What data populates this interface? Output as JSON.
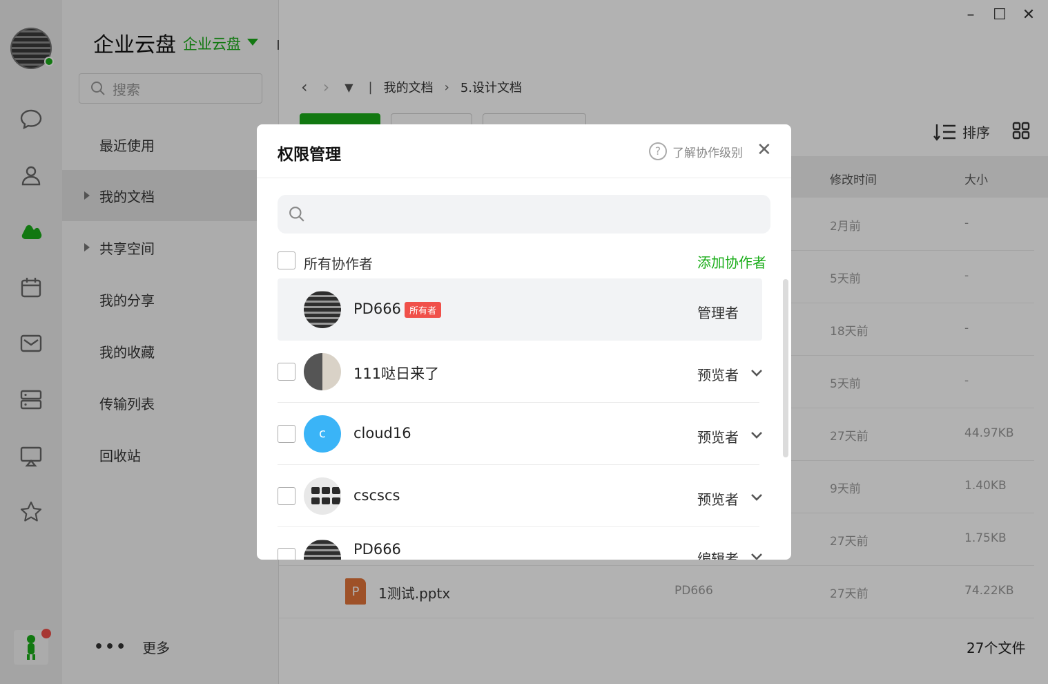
{
  "app": {
    "title": "企业云盘",
    "title_sub": "企业云盘"
  },
  "nav": {
    "search_placeholder": "搜索",
    "items": [
      {
        "label": "最近使用"
      },
      {
        "label": "我的文档"
      },
      {
        "label": "共享空间"
      },
      {
        "label": "我的分享"
      },
      {
        "label": "我的收藏"
      },
      {
        "label": "传输列表"
      },
      {
        "label": "回收站"
      }
    ],
    "more_label": "更多"
  },
  "window": {
    "minimize": "–",
    "maximize": "☐",
    "close": "✕"
  },
  "breadcrumb": {
    "root": "我的文档",
    "current": "5.设计文档"
  },
  "toolbar": {
    "sort_label": "排序"
  },
  "table": {
    "headers": {
      "modified": "修改时间",
      "size": "大小"
    },
    "rows": [
      {
        "time": "2月前",
        "size": "-"
      },
      {
        "time": "5天前",
        "size": "-"
      },
      {
        "time": "18天前",
        "size": "-"
      },
      {
        "time": "5天前",
        "size": "-"
      },
      {
        "time": "27天前",
        "size": "44.97KB"
      },
      {
        "time": "9天前",
        "size": "1.40KB"
      },
      {
        "time": "27天前",
        "size": "1.75KB"
      },
      {
        "name": "1测试.pptx",
        "owner": "PD666",
        "time": "27天前",
        "size": "74.22KB",
        "icon_letter": "P"
      }
    ],
    "file_count": "27个文件"
  },
  "modal": {
    "title": "权限管理",
    "help_label": "了解协作级别",
    "search_placeholder": "",
    "all_collaborators_label": "所有协作者",
    "add_collaborator_label": "添加协作者",
    "collaborators": [
      {
        "name": "PD666",
        "badge": "所有者",
        "role": "管理者"
      },
      {
        "name": "111哒日来了",
        "role": "预览者"
      },
      {
        "name": "cloud16",
        "role": "预览者",
        "avatar_letter": "c"
      },
      {
        "name": "cscscs",
        "role": "预览者"
      },
      {
        "name": "PD666",
        "role": "编辑者"
      }
    ]
  },
  "colors": {
    "accent": "#1aad19",
    "badge": "#f0504a",
    "avatar_blue": "#3ab4f7"
  }
}
